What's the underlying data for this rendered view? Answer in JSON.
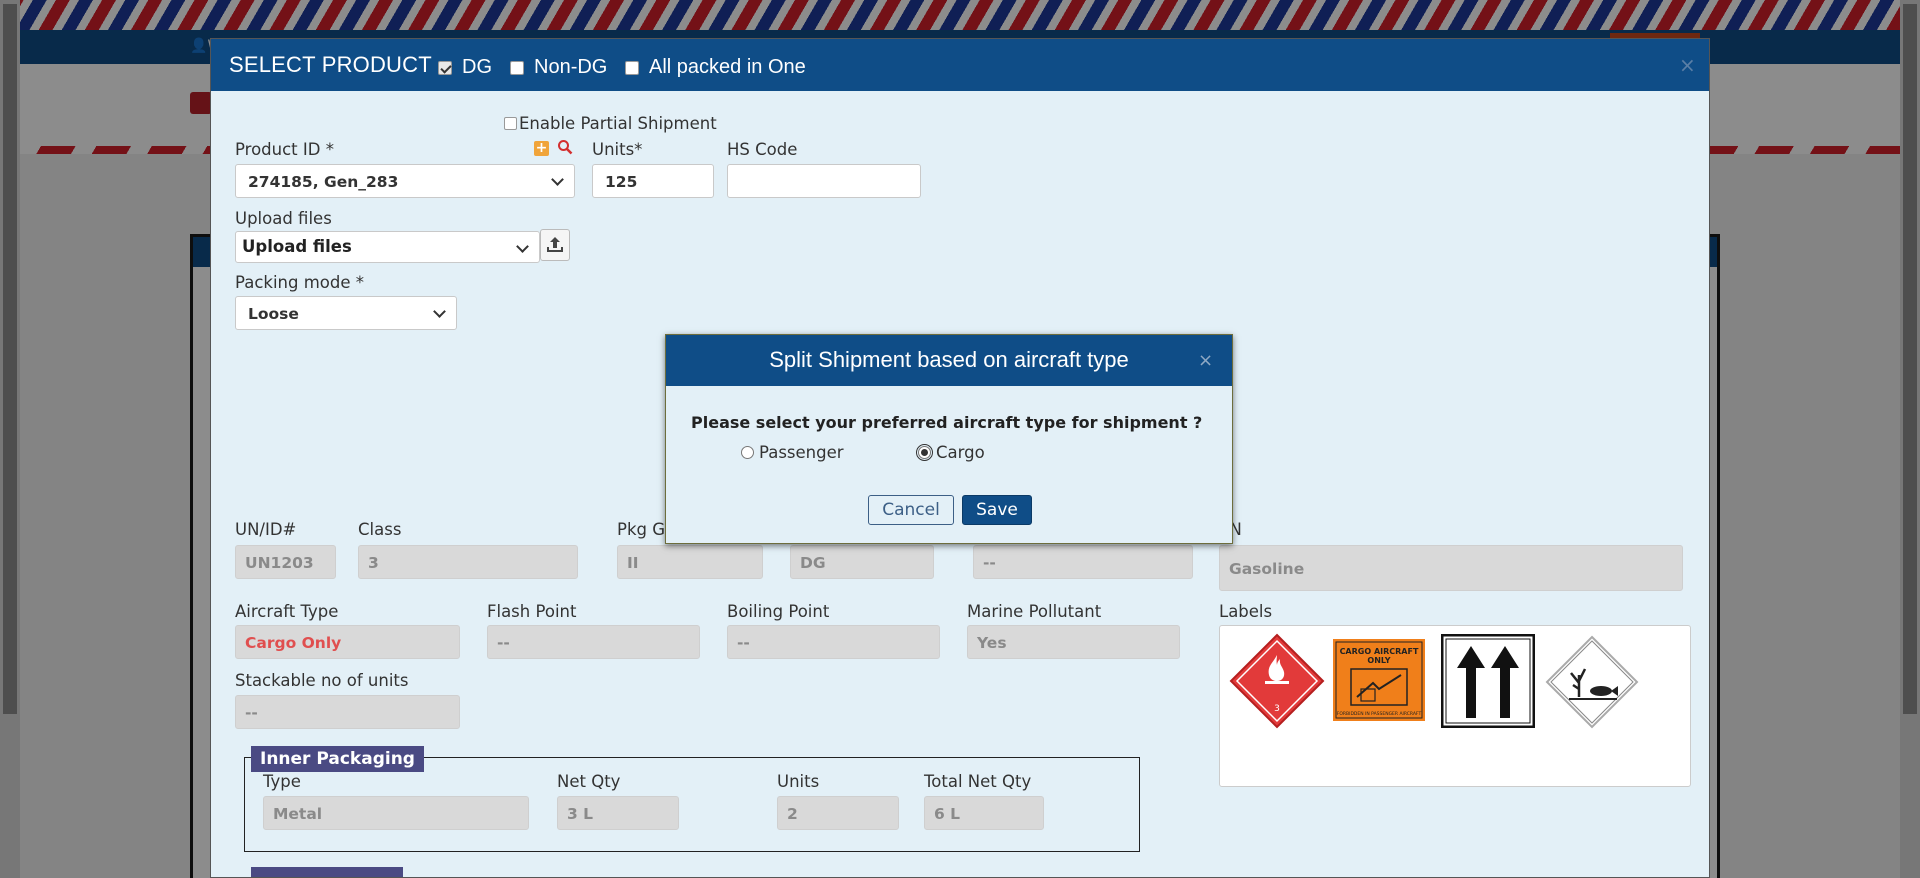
{
  "modal": {
    "title": "SELECT PRODUCT",
    "options": [
      {
        "label": "DG",
        "checked": true
      },
      {
        "label": "Non-DG",
        "checked": false
      },
      {
        "label": "All packed in One",
        "checked": false
      }
    ],
    "close": "×"
  },
  "form": {
    "enable_partial_shipment": "Enable Partial Shipment",
    "product_id_label": "Product ID *",
    "product_id_value": "274185, Gen_283",
    "units_label": "Units*",
    "units_value": "125",
    "hs_code_label": "HS Code",
    "hs_code_value": "",
    "upload_files_label": "Upload files",
    "upload_files_value": "Upload files",
    "packing_mode_label": "Packing mode *",
    "packing_mode_value": "Loose",
    "un_id_label": "UN/ID#",
    "un_id_value": "UN1203",
    "class_label": "Class",
    "class_value": "3",
    "pkg_group_label": "Pkg Gr",
    "pkg_group_value": "II",
    "dg_value": "DG",
    "dash_value": "--",
    "psn_label": "SN",
    "psn_value": "Gasoline",
    "aircraft_type_label": "Aircraft Type",
    "aircraft_type_value": "Cargo Only",
    "flash_point_label": "Flash Point",
    "flash_point_value": "--",
    "boiling_point_label": "Boiling Point",
    "boiling_point_value": "--",
    "marine_pollutant_label": "Marine Pollutant",
    "marine_pollutant_value": "Yes",
    "labels_label": "Labels",
    "stackable_label": "Stackable no of units",
    "stackable_value": "--"
  },
  "labels": {
    "flammable_number": "3",
    "cargo_line1": "CARGO AIRCRAFT",
    "cargo_line2": "ONLY",
    "cargo_footer": "FORBIDDEN IN PASSENGER AIRCRAFT"
  },
  "inner_packaging": {
    "legend": "Inner Packaging",
    "type_label": "Type",
    "type_value": "Metal",
    "net_qty_label": "Net Qty",
    "net_qty_value": "3 L",
    "units_label": "Units",
    "units_value": "2",
    "total_net_qty_label": "Total Net Qty",
    "total_net_qty_value": "6 L"
  },
  "background": {
    "user_link": "W"
  },
  "split_dialog": {
    "title": "Split Shipment based on aircraft type",
    "close": "×",
    "question": "Please select your preferred aircraft type for shipment ?",
    "options": [
      {
        "label": "Passenger",
        "selected": false
      },
      {
        "label": "Cargo",
        "selected": true
      }
    ],
    "cancel": "Cancel",
    "save": "Save"
  },
  "colors": {
    "header_blue": "#0f4d87",
    "modal_bg": "#e3f0f7",
    "legend_purple": "#4a4a83",
    "aircraft_red": "#e04f4f"
  }
}
